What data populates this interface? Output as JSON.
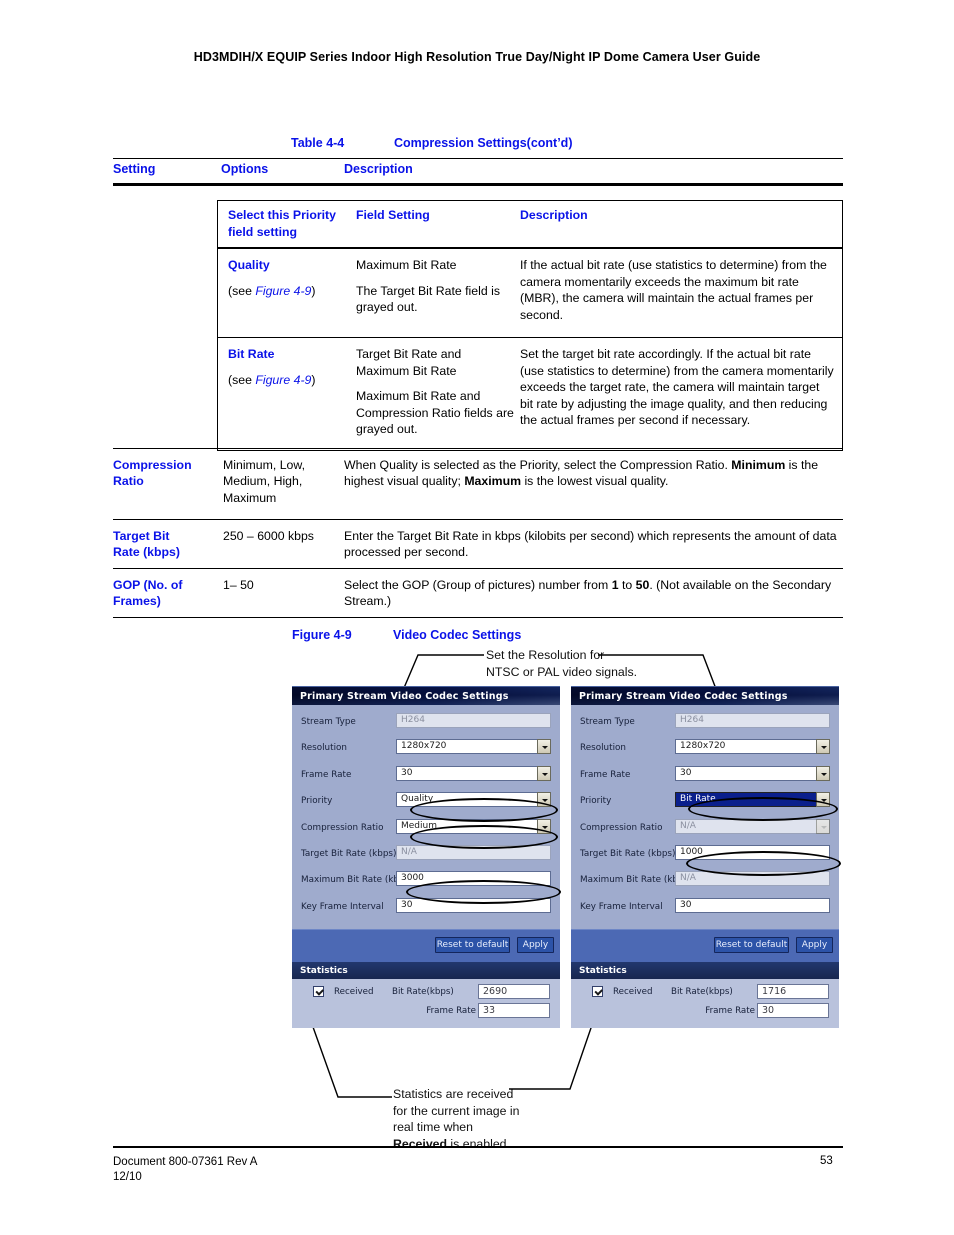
{
  "running_head": "HD3MDIH/X EQUIP Series Indoor High Resolution True Day/Night IP Dome Camera User Guide",
  "table": {
    "caption_number": "Table 4-4",
    "caption_title": "Compression Settings(cont’d)",
    "headers": [
      "Setting",
      "Options",
      "Description"
    ],
    "inner_table": {
      "headers": [
        "Select this Priority field setting",
        "Field Setting",
        "Description"
      ],
      "header_col1_line1": "Select this Priority",
      "header_col1_line2": "field setting",
      "rows": [
        {
          "setting": "Quality",
          "setting_ref_prefix": "(see ",
          "setting_ref": "Figure 4-9",
          "setting_ref_suffix": ")",
          "field_setting_1": "Maximum Bit Rate",
          "field_setting_2": "The Target Bit Rate field is grayed out.",
          "description": "If the actual bit rate (use statistics to determine) from the camera momentarily exceeds the maximum bit rate (MBR), the camera will maintain the actual frames per second."
        },
        {
          "setting": "Bit Rate",
          "setting_ref_prefix": "(see ",
          "setting_ref": "Figure 4-9",
          "setting_ref_suffix": ")",
          "field_setting_1": "Target Bit Rate and Maximum Bit Rate",
          "field_setting_2": "Maximum Bit Rate and Compression Ratio fields are grayed out.",
          "description": "Set the target bit rate accordingly. If the actual bit rate (use statistics to determine) from the camera momentarily exceeds the target rate, the camera will maintain target bit rate by adjusting the image quality, and then reducing the actual frames per second if necessary."
        }
      ]
    },
    "rows": [
      {
        "setting_line1": "Compression",
        "setting_line2": "Ratio",
        "options": "Minimum, Low, Medium, High, Maximum",
        "desc_part1": "When Quality is selected as the Priority, select the Compression Ratio. ",
        "desc_bold1": "Minimum",
        "desc_part2": " is the highest visual quality; ",
        "desc_bold2": "Maximum",
        "desc_part3": " is the lowest visual quality."
      },
      {
        "setting_line1": "Target Bit",
        "setting_line2": "Rate (kbps)",
        "options": "250 – 6000 kbps",
        "desc_part1": "Enter the Target Bit Rate in kbps (kilobits per second) which represents the amount of data processed per second."
      },
      {
        "setting_line1": "GOP (No. of",
        "setting_line2": "Frames)",
        "options": "1– 50",
        "desc_part1": "Select the GOP (Group of pictures) number from ",
        "desc_bold1": "1",
        "desc_part2": " to ",
        "desc_bold2": "50",
        "desc_part3": ". (Not available on the Secondary Stream.)"
      }
    ]
  },
  "figure": {
    "caption_number": "Figure 4-9",
    "caption_title": "Video Codec Settings",
    "annotation_top_line1": "Set the Resolution for",
    "annotation_top_line2": "NTSC or PAL video signals.",
    "annotation_bottom_line1": "Statistics are received",
    "annotation_bottom_line2": "for the current image in",
    "annotation_bottom_line3": "real time when",
    "annotation_bottom_bold": "Received",
    "annotation_bottom_line4": " is enabled."
  },
  "panels": {
    "left": {
      "title": "Primary Stream Video Codec Settings",
      "fields": [
        {
          "label": "Stream Type",
          "value": "H264",
          "state": "disabled",
          "dropdown": false
        },
        {
          "label": "Resolution",
          "value": "1280x720",
          "state": "normal",
          "dropdown": true
        },
        {
          "label": "Frame Rate",
          "value": "30",
          "state": "normal",
          "dropdown": true
        },
        {
          "label": "Priority",
          "value": "Quality",
          "state": "normal",
          "dropdown": true,
          "highlighted": true
        },
        {
          "label": "Compression Ratio",
          "value": "Medium",
          "state": "normal",
          "dropdown": true,
          "highlighted": true
        },
        {
          "label": "Target Bit Rate (kbps)",
          "value": "N/A",
          "state": "disabled",
          "dropdown": false
        },
        {
          "label": "Maximum Bit Rate (kbps)",
          "value": "3000",
          "state": "normal",
          "dropdown": false,
          "highlighted": true
        },
        {
          "label": "Key Frame Interval",
          "value": "30",
          "state": "normal",
          "dropdown": false
        }
      ],
      "buttons": {
        "reset": "Reset to default",
        "apply": "Apply"
      },
      "statistics": {
        "title": "Statistics",
        "received_label": "Received",
        "bitrate_label": "Bit Rate(kbps)",
        "bitrate_value": "2690",
        "framerate_label": "Frame Rate",
        "framerate_value": "33",
        "received_checked": true
      }
    },
    "right": {
      "title": "Primary Stream Video Codec Settings",
      "fields": [
        {
          "label": "Stream Type",
          "value": "H264",
          "state": "disabled",
          "dropdown": false
        },
        {
          "label": "Resolution",
          "value": "1280x720",
          "state": "normal",
          "dropdown": true
        },
        {
          "label": "Frame Rate",
          "value": "30",
          "state": "normal",
          "dropdown": true
        },
        {
          "label": "Priority",
          "value": "Bit Rate",
          "state": "selected",
          "dropdown": true,
          "highlighted": true
        },
        {
          "label": "Compression Ratio",
          "value": "N/A",
          "state": "disabled",
          "dropdown": true
        },
        {
          "label": "Target Bit Rate (kbps)",
          "value": "1000",
          "state": "normal",
          "dropdown": false,
          "highlighted": true
        },
        {
          "label": "Maximum Bit Rate (kbps)",
          "value": "N/A",
          "state": "disabled",
          "dropdown": false
        },
        {
          "label": "Key Frame Interval",
          "value": "30",
          "state": "normal",
          "dropdown": false
        }
      ],
      "buttons": {
        "reset": "Reset to default",
        "apply": "Apply"
      },
      "statistics": {
        "title": "Statistics",
        "received_label": "Received",
        "bitrate_label": "Bit Rate(kbps)",
        "bitrate_value": "1716",
        "framerate_label": "Frame Rate",
        "framerate_value": "30",
        "received_checked": true
      }
    }
  },
  "footer": {
    "document": "Document 800-07361 Rev A",
    "date": "12/10",
    "page_number": "53"
  },
  "colors": {
    "heading_blue": "#0a12e8",
    "panel_title_navy": "#1d3166",
    "panel_body": "#9fabcd",
    "button_bar": "#4c69b4",
    "selection_blue": "#0a1f8c"
  }
}
